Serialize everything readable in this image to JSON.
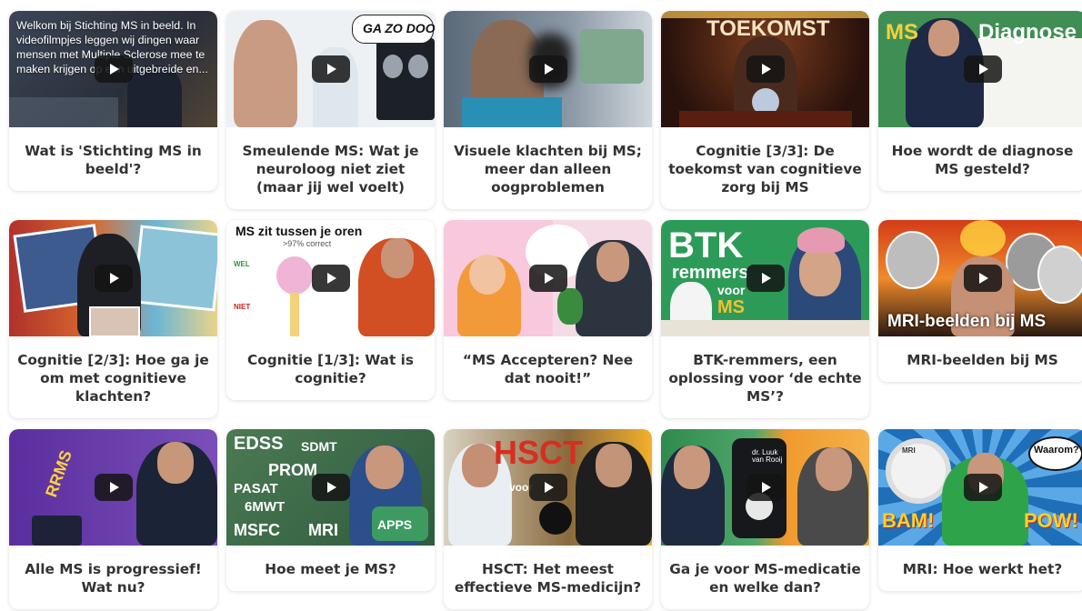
{
  "videos": [
    {
      "title": "Wat is 'Stichting MS in beeld'?",
      "overlay": "Welkom bij Stichting MS in beeld. In videofilmpjes leggen wij dingen waar mensen met Multiple Sclerose mee te maken krijgen op een uitgebreide en..."
    },
    {
      "title": "Smeulende MS: Wat je neu­roloog niet ziet (maar jij wel voelt)",
      "thumb_text": "GA ZO DOOR!"
    },
    {
      "title": "Visuele klachten bij MS; meer dan alleen oogproblemen"
    },
    {
      "title": "Cognitie [3/3]: De toekomst van cognitieve zorg bij MS",
      "thumb_text": "TOEKOMST"
    },
    {
      "title": "Hoe wordt de diagnose MS gesteld?",
      "thumb_text_1": "MS",
      "thumb_text_2": "Diagnose"
    },
    {
      "title": "Cognitie [2/3]: Hoe ga je om met cognitieve klachten?"
    },
    {
      "title": "Cognitie [1/3]: Wat is cognitie?",
      "thumb_text": "MS zit tussen je oren",
      "thumb_sub": ">97% correct",
      "thumb_wel": "WEL",
      "thumb_niet": "NIET"
    },
    {
      "title": "“MS Accepteren? Nee dat nooit!”"
    },
    {
      "title": "BTK-remmers, een oplossing voor ‘de echte MS’?",
      "thumb_text_1": "BTK",
      "thumb_text_2": "remmers",
      "thumb_text_3": "voor",
      "thumb_text_4": "MS"
    },
    {
      "title": "MRI-beelden bij MS",
      "thumb_text": "MRI-beelden bij MS"
    },
    {
      "title": "Alle MS is progressief! Wat nu?",
      "thumb_text": "RRMS"
    },
    {
      "title": "Hoe meet je MS?",
      "thumb_text_1": "EDSS",
      "thumb_text_2": "SDMT",
      "thumb_text_3": "PROM",
      "thumb_text_4": "PASAT",
      "thumb_text_5": "6MWT",
      "thumb_text_6": "MSFC",
      "thumb_text_7": "MRI",
      "thumb_text_8": "APPS"
    },
    {
      "title": "HSCT: Het meest effectieve MS-medicijn?",
      "thumb_text_1": "HSCT",
      "thumb_text_2": "voor"
    },
    {
      "title": "Ga je voor MS-medicatie en welke dan?",
      "thumb_text": "dr. Luuk van Rooij"
    },
    {
      "title": "MRI: Hoe werkt het?",
      "thumb_text_1": "MRI",
      "thumb_text_2": "Waarom?",
      "thumb_text_3": "BAM!",
      "thumb_text_4": "POW!"
    }
  ],
  "colors": {
    "card_bg": "#ffffff",
    "title_text": "#333333",
    "play_button": "#141414"
  }
}
